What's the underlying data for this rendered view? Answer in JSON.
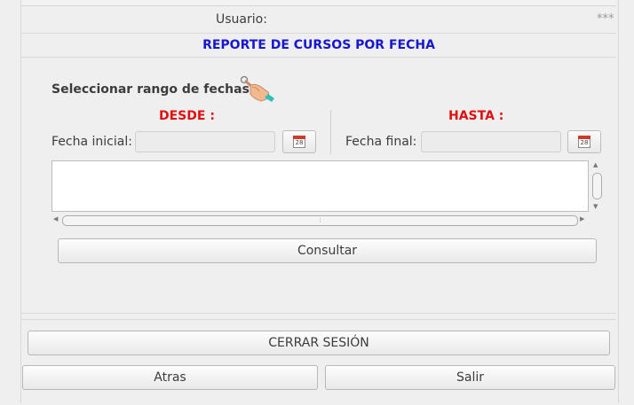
{
  "header": {
    "user_label": "Usuario:",
    "user_value": "***"
  },
  "report": {
    "title": "REPORTE DE CURSOS POR FECHA"
  },
  "range": {
    "select_label": "Seleccionar rango de fechas:"
  },
  "from": {
    "heading": "DESDE :",
    "label": "Fecha inicial:",
    "value": "",
    "calendar_day": "28"
  },
  "to": {
    "heading": "HASTA :",
    "label": "Fecha final:",
    "value": "",
    "calendar_day": "28"
  },
  "results": {
    "text": ""
  },
  "actions": {
    "consult": "Consultar",
    "logout": "CERRAR SESIÓN",
    "back": "Atras",
    "exit": "Salir"
  },
  "icons": {
    "hand": "pointing-hand-icon",
    "calendar": "calendar-icon"
  },
  "colors": {
    "title_blue": "#1717d0",
    "heading_red": "#e01010"
  }
}
